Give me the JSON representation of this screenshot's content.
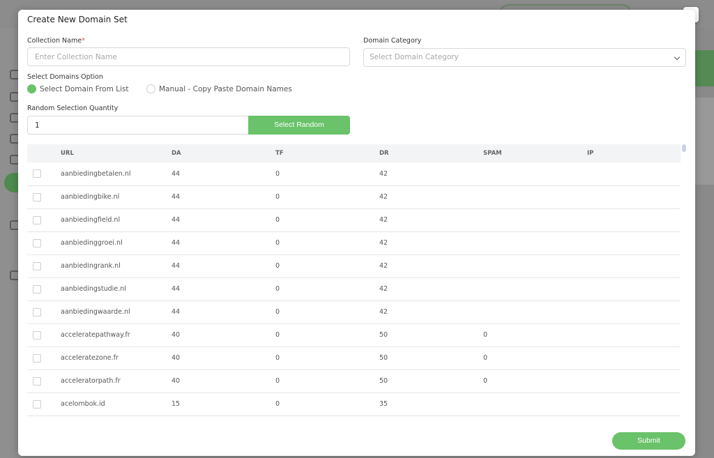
{
  "modal": {
    "title": "Create New Domain Set",
    "close_label": "×"
  },
  "form": {
    "collection_name": {
      "label": "Collection Name",
      "required_mark": "*",
      "placeholder": "Enter Collection Name",
      "value": ""
    },
    "domain_category": {
      "label": "Domain Category",
      "placeholder": "Select Domain Category"
    },
    "select_option": {
      "label": "Select Domains Option",
      "options": [
        {
          "label": "Select Domain From List",
          "selected": true
        },
        {
          "label": "Manual - Copy Paste Domain Names",
          "selected": false
        }
      ]
    },
    "random_quantity": {
      "label": "Random Selection Quantity",
      "value": "1",
      "button_label": "Select Random"
    }
  },
  "table": {
    "columns": [
      "URL",
      "DA",
      "TF",
      "DR",
      "SPAM",
      "IP"
    ],
    "rows": [
      {
        "url": "aanbiedingbetalen.nl",
        "da": "44",
        "tf": "0",
        "dr": "42",
        "spam": "",
        "ip": ""
      },
      {
        "url": "aanbiedingbike.nl",
        "da": "44",
        "tf": "0",
        "dr": "42",
        "spam": "",
        "ip": ""
      },
      {
        "url": "aanbiedingfield.nl",
        "da": "44",
        "tf": "0",
        "dr": "42",
        "spam": "",
        "ip": ""
      },
      {
        "url": "aanbiedinggroei.nl",
        "da": "44",
        "tf": "0",
        "dr": "42",
        "spam": "",
        "ip": ""
      },
      {
        "url": "aanbiedingrank.nl",
        "da": "44",
        "tf": "0",
        "dr": "42",
        "spam": "",
        "ip": ""
      },
      {
        "url": "aanbiedingstudie.nl",
        "da": "44",
        "tf": "0",
        "dr": "42",
        "spam": "",
        "ip": ""
      },
      {
        "url": "aanbiedingwaarde.nl",
        "da": "44",
        "tf": "0",
        "dr": "42",
        "spam": "",
        "ip": ""
      },
      {
        "url": "acceleratepathway.fr",
        "da": "40",
        "tf": "0",
        "dr": "50",
        "spam": "0",
        "ip": ""
      },
      {
        "url": "acceleratezone.fr",
        "da": "40",
        "tf": "0",
        "dr": "50",
        "spam": "0",
        "ip": ""
      },
      {
        "url": "acceleratorpath.fr",
        "da": "40",
        "tf": "0",
        "dr": "50",
        "spam": "0",
        "ip": ""
      },
      {
        "url": "acelombok.id",
        "da": "15",
        "tf": "0",
        "dr": "35",
        "spam": "",
        "ip": ""
      }
    ]
  },
  "footer": {
    "submit_label": "Submit"
  },
  "colors": {
    "accent": "#6ac26a",
    "required": "#e04b4b",
    "overlay": "#8a8a8a"
  }
}
